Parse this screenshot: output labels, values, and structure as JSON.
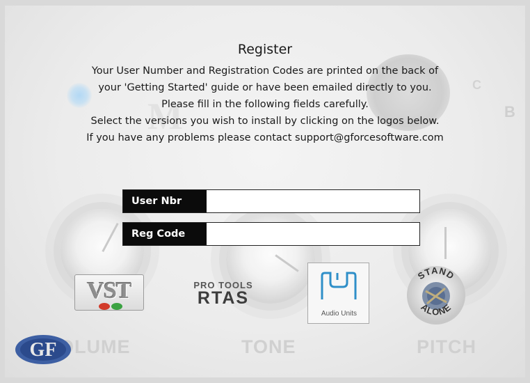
{
  "dialog": {
    "title": "Register",
    "info_lines": [
      "Your User Number and Registration Codes are printed on the back of",
      "your 'Getting Started' guide or have been emailed directly to you.",
      "Please fill in the following fields carefully.",
      "Select the versions you wish to install by clicking on the logos below.",
      "If you have any problems please contact support@gforcesoftware.com"
    ]
  },
  "form": {
    "user_nbr_label": "User Nbr",
    "user_nbr_value": "",
    "reg_code_label": "Reg Code",
    "reg_code_value": ""
  },
  "logos": {
    "vst": "VST",
    "rtas_top": "PRO TOOLS",
    "rtas_bottom": "RTAS",
    "au_label": "Audio Units",
    "stand_top": "STAND",
    "stand_bottom": "ALONE",
    "brand": "GF"
  },
  "background": {
    "knob_labels": [
      "OLUME",
      "TONE",
      "PITCH"
    ],
    "side_letters": [
      "B",
      "C"
    ]
  },
  "colors": {
    "label_bg": "#0b0b0b",
    "glow": "#b4d8f4"
  }
}
